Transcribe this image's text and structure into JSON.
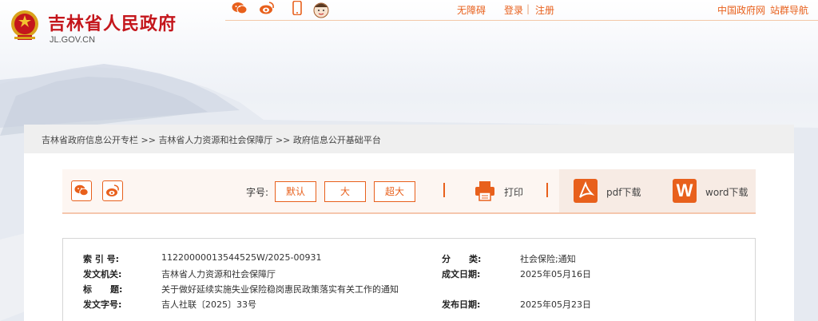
{
  "header": {
    "site_title": "吉林省人民政府",
    "domain": "JL.GOV.CN"
  },
  "topbar": {
    "share_icons": [
      "wechat-icon",
      "weibo-icon",
      "mobile-icon",
      "mascot-icon"
    ],
    "accessibility": "无障碍",
    "login": "登录",
    "register": "注册",
    "separator": "|",
    "china_gov": "中国政府网",
    "site_nav": "站群导航"
  },
  "breadcrumb": {
    "items": [
      "吉林省政府信息公开专栏",
      "吉林省人力资源和社会保障厅",
      "政府信息公开基础平台"
    ],
    "separator": ">>"
  },
  "toolbar": {
    "font_size_label": "字号:",
    "font_default": "默认",
    "font_large": "大",
    "font_xlarge": "超大",
    "print": "打印",
    "pdf_download": "pdf下载",
    "word_download": "word下载",
    "word_letter": "W"
  },
  "document_info": {
    "index_label": "索 引 号:",
    "index_value": "11220000013544525W/2025-00931",
    "category_label": "分      类:",
    "category_value": "社会保险;通知",
    "issuer_label": "发文机关:",
    "issuer_value": "吉林省人力资源和社会保障厅",
    "date_written_label": "成文日期:",
    "date_written_value": "2025年05月16日",
    "title_label": "标      题:",
    "title_value": "关于做好延续实施失业保险稳岗惠民政策落实有关工作的通知",
    "doc_number_label": "发文字号:",
    "doc_number_value": "吉人社联〔2025〕33号",
    "publish_date_label": "发布日期:",
    "publish_date_value": "2025年05月23日"
  },
  "colors": {
    "brand_red": "#c4161c",
    "accent_orange": "#e8601c"
  }
}
